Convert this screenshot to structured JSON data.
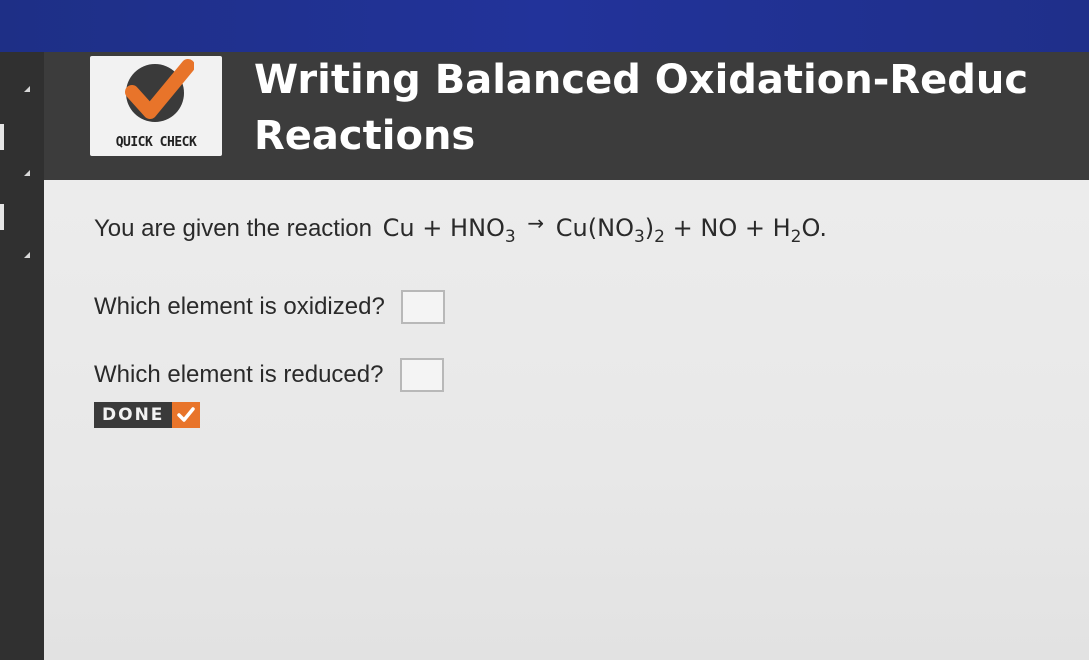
{
  "header": {
    "badge_label": "QUICK CHECK",
    "title_line1": "Writing Balanced Oxidation-Reduc",
    "title_line2": "Reactions"
  },
  "question": {
    "intro": "You are given the reaction",
    "equation": {
      "r1": "Cu",
      "plus1": "+",
      "r2": "HNO",
      "r2_sub": "3",
      "arrow": "→",
      "p1": "Cu(NO",
      "p1_sub": "3",
      "p1_close": ")",
      "p1_sub2": "2",
      "plus2": "+",
      "p2": "NO",
      "plus3": "+",
      "p3": "H",
      "p3_sub": "2",
      "p3_end": "O."
    },
    "q1_label": "Which element is oxidized?",
    "q1_value": "",
    "q2_label": "Which element is reduced?",
    "q2_value": ""
  },
  "done_button": {
    "label": "DONE",
    "icon": "checkmark-icon"
  },
  "colors": {
    "accent": "#e8742a",
    "header_bg": "#3c3c3c",
    "top_band": "#22339a",
    "content_bg": "#ececec"
  }
}
